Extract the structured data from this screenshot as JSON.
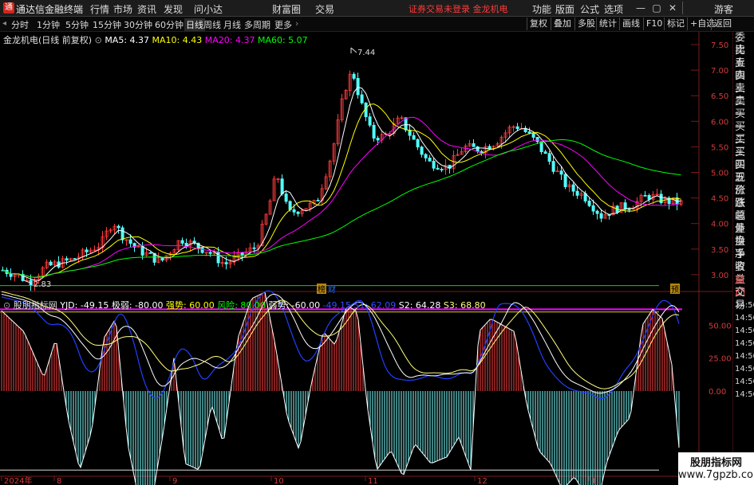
{
  "menubar": {
    "app_name": "通达信金融终端",
    "menus": [
      "行情",
      "市场",
      "资讯",
      "发现",
      "问小达",
      "财富圈",
      "交易"
    ],
    "notice": "证券交易未登录 金龙机电",
    "right_menus": [
      "功能",
      "版面",
      "公式",
      "选项"
    ],
    "guest": "游客"
  },
  "periodbar": {
    "periods": [
      "分时",
      "1分钟",
      "5分钟",
      "15分钟",
      "30分钟",
      "60分钟",
      "日线",
      "周线",
      "月线",
      "多周期",
      "更多"
    ],
    "active": "日线",
    "right_buttons": [
      "复权",
      "叠加",
      "多股",
      "统计",
      "画线",
      "F10",
      "标记",
      "+自选",
      "返回"
    ]
  },
  "main_legend": {
    "title": "金龙机电(日线 前复权)",
    "ma5": "MA5: 4.37",
    "ma10": "MA10: 4.43",
    "ma20": "MA20: 4.37",
    "ma60": "MA60: 5.07"
  },
  "sub_legend": {
    "name": "股朋指标网",
    "yjd": "YJD: -49.15",
    "jiruo": "极弱: -80.00",
    "qiangshi": "强势: 60.00",
    "fengxian": "风险: 80.00",
    "ruoshi": "弱势: -60.00",
    "s1": "-49.15 S1: 62.09",
    "s2": "S2: 64.28",
    "s3": "S3: 68.80"
  },
  "price_axis": [
    "7.50",
    "7.00",
    "6.50",
    "6.00",
    "5.50",
    "5.00",
    "4.50",
    "4.00",
    "3.50",
    "3.00"
  ],
  "sub_axis": [
    "50.00",
    "25.00",
    "0.00"
  ],
  "annotations": {
    "high": "7.44",
    "low": "2.83",
    "marker1": "榜",
    "marker2": "财",
    "marker3": "预"
  },
  "date_axis": [
    "2024年",
    "8",
    "9",
    "10",
    "11",
    "12",
    "1"
  ],
  "right_panel": [
    "委比",
    "卖五",
    "卖四",
    "卖三",
    "卖二",
    "卖一",
    "买一",
    "买二",
    "买三",
    "买四",
    "买五",
    "现价",
    "涨跌",
    "涨幅",
    "总量",
    "外盘",
    "换手",
    "净资",
    "收益",
    "自动",
    "交易",
    "14:56",
    "14:56",
    "14:56",
    "14:56",
    "14:56",
    "14:56",
    "14:56",
    "14:56"
  ],
  "watermark": {
    "line1": "股朋指标网",
    "line2": "www.7gpzb.com"
  },
  "colors": {
    "up": "#ff3b3b",
    "down": "#54ffff",
    "ma5": "#ffffff",
    "ma10": "#ffff00",
    "ma20": "#ff00ff",
    "ma60": "#00ff00"
  }
}
